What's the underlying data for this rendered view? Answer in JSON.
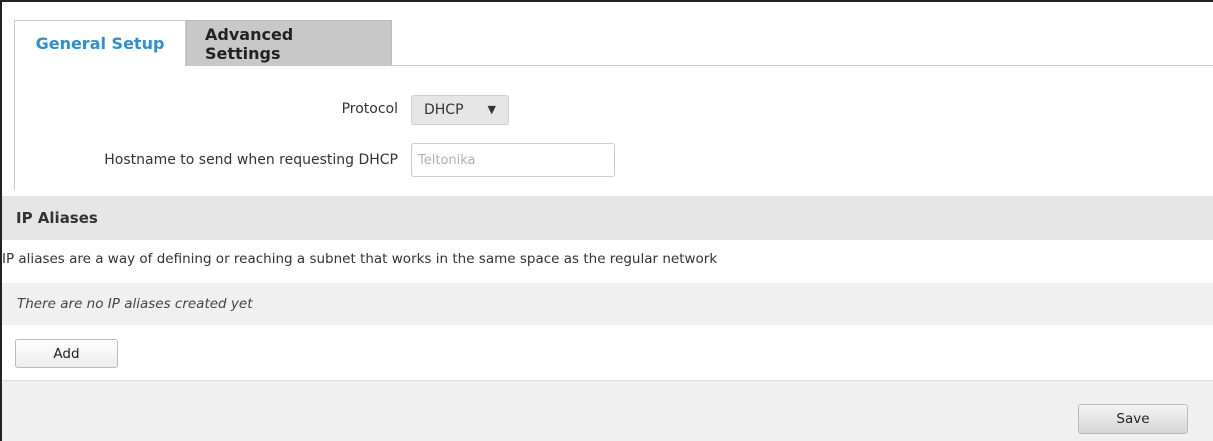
{
  "tabs": [
    {
      "label": "General Setup",
      "active": true
    },
    {
      "label": "Advanced Settings",
      "active": false
    }
  ],
  "general": {
    "protocol_label": "Protocol",
    "protocol_value": "DHCP",
    "hostname_label": "Hostname to send when requesting DHCP",
    "hostname_placeholder": "Teltonika"
  },
  "aliases": {
    "title": "IP Aliases",
    "description": "IP aliases are a way of defining or reaching a subnet that works in the same space as the regular network",
    "empty_text": "There are no IP aliases created yet",
    "add_label": "Add"
  },
  "footer": {
    "save_label": "Save"
  },
  "colors": {
    "accent": "#2d8fd0",
    "section_bg": "#e6e6e6"
  }
}
